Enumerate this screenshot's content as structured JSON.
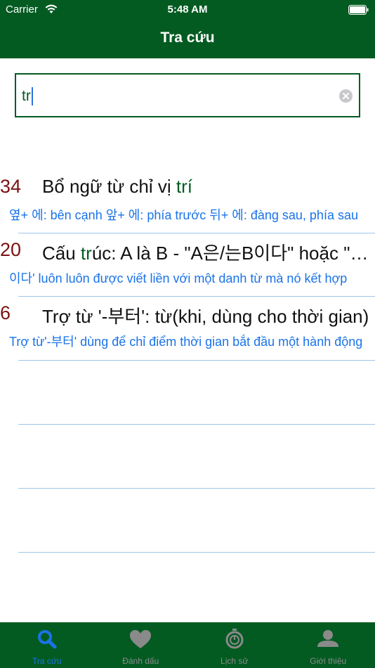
{
  "status_bar": {
    "carrier": "Carrier",
    "time": "5:48 AM"
  },
  "nav": {
    "title": "Tra cứu"
  },
  "search": {
    "value": "tr"
  },
  "results": [
    {
      "number": "34",
      "title_pre": "Bổ ngữ từ chỉ vị ",
      "title_hl": "trí",
      "title_post": "",
      "subtitle": "옆+ 에: bên cạnh    앞+ 에: phía trước   뒤+ 에: đàng sau, phía sau"
    },
    {
      "number": "20",
      "title_pre": "Cấu ",
      "title_hl": "tr",
      "title_post": "úc: A là B - \"A은/는B이다\" hoặc \"A은/는B이에요\"",
      "subtitle": "이다' luôn luôn được viết liền với một danh từ mà nó kết hợp"
    },
    {
      "number": "6",
      "title_pre": "Trợ từ '-부터': từ(khi, dùng cho thời gian)",
      "title_hl": "",
      "title_post": "",
      "subtitle": "Trợ từ'-부터' dùng để chỉ điểm thời gian bắt đầu một hành động"
    }
  ],
  "tabs": [
    {
      "label": "Tra cứu",
      "icon": "search-icon",
      "active": true
    },
    {
      "label": "Đánh dấu",
      "icon": "heart-icon",
      "active": false
    },
    {
      "label": "Lịch sử",
      "icon": "stopwatch-icon",
      "active": false
    },
    {
      "label": "Giới thiệu",
      "icon": "person-icon",
      "active": false
    }
  ],
  "colors": {
    "brand_green": "#035b22",
    "number_red": "#7a1212",
    "link_blue": "#1a73e8"
  }
}
